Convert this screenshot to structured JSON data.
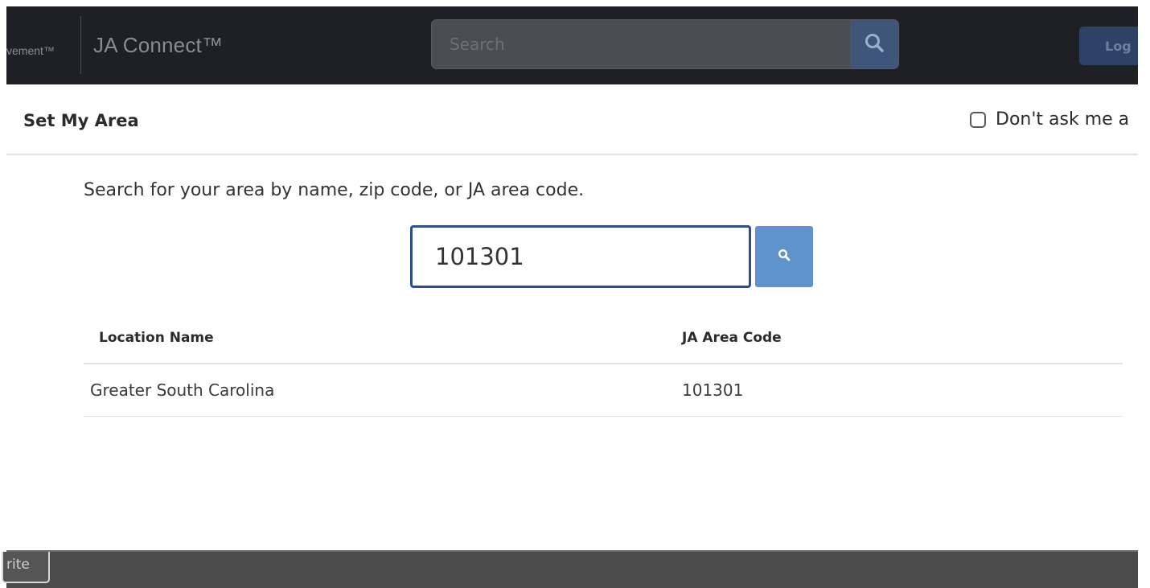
{
  "header": {
    "brand_partial": "vement™",
    "brand_name": "JA Connect™",
    "search_placeholder": "Search",
    "login_label": "Log"
  },
  "modal": {
    "title": "Set My Area",
    "dont_ask_label": "Don't ask me a",
    "dont_ask_checked": false,
    "instructions": "Search for your area by name, zip code, or JA area code.",
    "search_value": "101301",
    "table": {
      "columns": [
        "Location Name",
        "JA Area Code"
      ],
      "rows": [
        [
          "Greater South Carolina",
          "101301"
        ]
      ]
    }
  },
  "footer": {
    "button_label": "rite"
  },
  "colors": {
    "header_bg": "#1f2024",
    "search_btn": "#3d5679",
    "login_btn": "#2d4266",
    "input_border": "#2c4e8c",
    "area_search_btn": "#5e93cc",
    "footer_bg": "#4b4b4b"
  }
}
